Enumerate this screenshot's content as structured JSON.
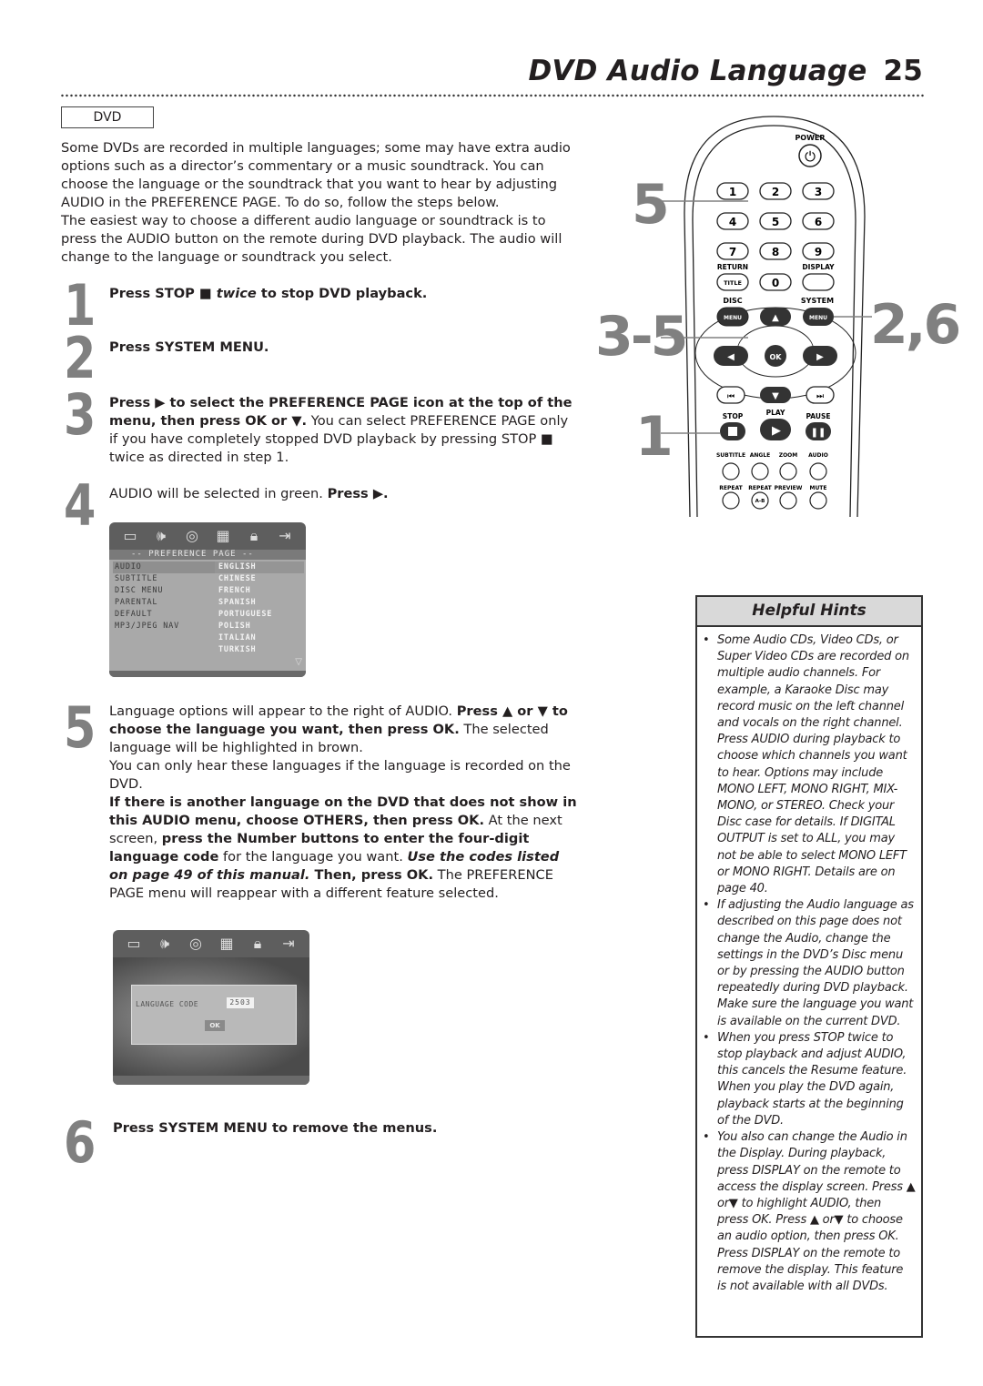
{
  "header": {
    "title": "DVD Audio Language",
    "page_number": "25"
  },
  "disc_tag": "DVD",
  "intro": [
    "Some DVDs are recorded in multiple languages; some may have extra audio options such as a director’s commentary or a music soundtrack. You can choose the language or the soundtrack that you want to hear by adjusting AUDIO in the PREFERENCE PAGE. To do so, follow the steps below.",
    "The easiest way to choose a different audio language or soundtrack is to press the AUDIO button on the remote during DVD playback. The audio will change to the language or soundtrack you select."
  ],
  "steps": [
    {
      "num": "1",
      "a": "Press STOP ■ ",
      "b": "twice",
      "c": " to stop DVD playback."
    },
    {
      "num": "2",
      "a": "Press SYSTEM MENU."
    },
    {
      "num": "3",
      "a": "Press ▶ to select the PREFERENCE PAGE icon at the top of the menu, then press OK or ▼.",
      "b": " You can select PREFERENCE PAGE only if you have completely stopped DVD playback by pressing STOP ■ twice as directed in step 1."
    },
    {
      "num": "4",
      "a": "AUDIO will be selected in green. ",
      "b": "Press ▶."
    },
    {
      "num": "5",
      "p1a": "Language options will appear to the right of AUDIO. ",
      "p1b": "Press ▲ or ▼ to choose the language you want, then press OK.",
      "p1c": " The selected language will be highlighted in brown.",
      "p2": "You can only hear these languages if the language is recorded on the DVD.",
      "p3a": "If there is another language on the DVD that does not show in this AUDIO menu, choose OTHERS, then press OK.",
      "p3b": " At the next screen, ",
      "p3c": "press the Number buttons to enter the four-digit language code",
      "p3d": " for the language you want. ",
      "p3e": "Use the codes listed on page 49 of this manual.",
      "p3f": " Then, press OK.",
      "p3g": " The PREFERENCE PAGE menu will reappear with a different feature selected."
    },
    {
      "num": "6",
      "a": "Press SYSTEM MENU to remove the menus."
    }
  ],
  "osd_preference": {
    "heading": "-- PREFERENCE PAGE --",
    "icons": [
      "tv-screen-icon",
      "speaker-icon",
      "disc-icon",
      "settings-board-icon",
      "padlock-icon",
      "exit-icon"
    ],
    "items": [
      "AUDIO",
      "SUBTITLE",
      "DISC MENU",
      "PARENTAL",
      "DEFAULT",
      "MP3/JPEG NAV"
    ],
    "languages": [
      "ENGLISH",
      "CHINESE",
      "FRENCH",
      "SPANISH",
      "PORTUGUESE",
      "POLISH",
      "ITALIAN",
      "TURKISH"
    ],
    "selected_item": "AUDIO",
    "selected_language": "ENGLISH"
  },
  "osd_language_code": {
    "label": "LANGUAGE CODE",
    "code": "2503",
    "ok_label": "OK"
  },
  "remote": {
    "power_label": "POWER",
    "number_keys": [
      "1",
      "2",
      "3",
      "4",
      "5",
      "6",
      "7",
      "8",
      "9"
    ],
    "return_label": "RETURN",
    "title_label": "TITLE",
    "zero_label": "0",
    "display_label": "DISPLAY",
    "disc_label": "DISC",
    "system_label": "SYSTEM",
    "menu_label": "MENU",
    "ok_label": "OK",
    "stop_label": "STOP",
    "play_label": "PLAY",
    "pause_label": "PAUSE",
    "row_labels_1": [
      "SUBTITLE",
      "ANGLE",
      "ZOOM",
      "AUDIO"
    ],
    "row_labels_2": [
      "REPEAT",
      "REPEAT",
      "PREVIEW",
      "MUTE"
    ],
    "ab_label": "A-B",
    "callouts": {
      "number_keys": "5",
      "arrows": "3-5",
      "system_menu": "2,6",
      "stop": "1"
    }
  },
  "hints": {
    "title": "Helpful Hints",
    "items": [
      "Some Audio CDs, Video CDs, or Super Video CDs are recorded on multiple audio channels. For example, a Karaoke Disc may record music on the left channel and vocals on the right channel. Press AUDIO during playback to choose which channels you want to hear. Options may include MONO LEFT, MONO RIGHT, MIX-MONO, or STEREO. Check your Disc case for details. If DIGITAL OUTPUT is set to ALL, you may not be able to select MONO LEFT or MONO RIGHT. Details are on page 40.",
      "If adjusting the Audio language as described on this page does not change the Audio, change the settings in the DVD’s Disc menu or by pressing the AUDIO button repeatedly during DVD playback. Make sure the language you want is available on the current DVD.",
      "When you press STOP twice to stop playback and adjust AUDIO, this cancels the Resume feature. When you play the DVD again, playback starts at the beginning of the DVD.",
      "You also can change the Audio in the Display. During playback, press DISPLAY on the remote to access the display screen. Press ▲ or▼ to highlight AUDIO, then press OK. Press ▲ or▼ to choose an audio option, then press OK. Press DISPLAY on the remote to remove the display. This feature is not available with all DVDs."
    ]
  }
}
